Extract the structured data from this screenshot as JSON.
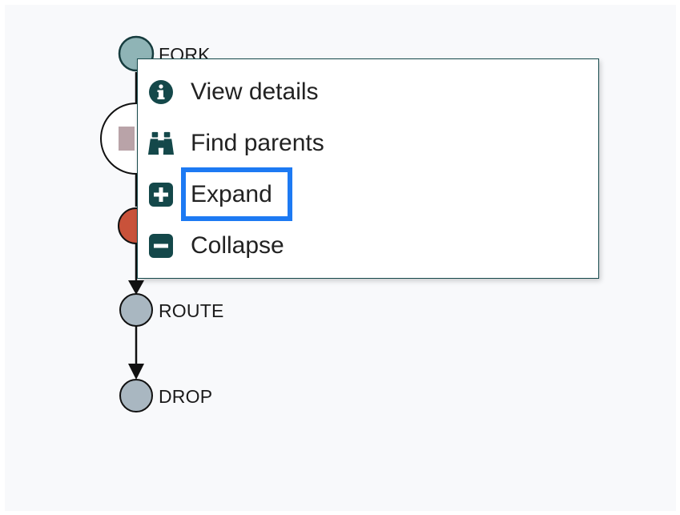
{
  "graph": {
    "nodes": [
      {
        "label": "FORK"
      },
      {
        "label": "ROUTE"
      },
      {
        "label": "DROP"
      }
    ]
  },
  "context_menu": {
    "items": [
      {
        "label": "View details",
        "icon": "info-circle-icon"
      },
      {
        "label": "Find parents",
        "icon": "binoculars-icon"
      },
      {
        "label": "Expand",
        "icon": "plus-square-icon"
      },
      {
        "label": "Collapse",
        "icon": "minus-square-icon"
      }
    ],
    "focused_item": "Expand"
  },
  "colors": {
    "accent": "#14484a",
    "node_gray": "#a9b7c1",
    "node_teal": "#8fb4b6",
    "node_red": "#c9523a",
    "focus": "#1d7af3",
    "background": "#f8f9fb"
  }
}
